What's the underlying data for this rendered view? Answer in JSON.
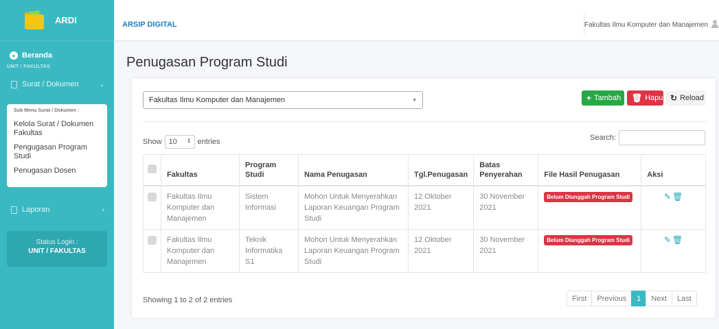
{
  "brand": {
    "name": "ARDI",
    "logo": "folder-logo-icon"
  },
  "sidebar": {
    "beranda": "Beranda",
    "section_label": "UNIT / FAKULTAS",
    "surat_menu": "Surat / Dokumen",
    "submenu_title": "Sub Menu Surat / Dokumen :",
    "submenu_items": [
      "Kelola Surat / Dokumen Fakultas",
      "Pengugasan Program Studi",
      "Penugasan Dosen"
    ],
    "laporan": "Laporan",
    "status_label": "Status Login :",
    "status_value": "UNIT / FAKULTAS"
  },
  "topbar": {
    "app_title": "ARSIP DIGITAL",
    "user": "Fakultas Ilmu Komputer dan Manajemen"
  },
  "page": {
    "title": "Penugasan Program Studi"
  },
  "filter": {
    "selected": "Fakultas Ilmu Komputer dan Manajemen"
  },
  "buttons": {
    "tambah": "Tambah",
    "hapus": "Hapus",
    "reload": "Reload"
  },
  "table_controls": {
    "show": "Show",
    "length": "10",
    "entries": "entries",
    "search_label": "Search:"
  },
  "table": {
    "headers": [
      "Fakultas",
      "Program Studi",
      "Nama Penugasan",
      "Tgl.Penugasan",
      "Batas Penyerahan",
      "File Hasil Penugasan",
      "Aksi"
    ],
    "rows": [
      {
        "fakultas": "Fakultas Ilmu Komputer dan Manajemen",
        "prodi": "Sistem Informasi",
        "nama": "Mohon Untuk Menyerahkan Laporan Keuangan Program Studi",
        "tgl": "12 Oktober 2021",
        "batas": "30 November 2021",
        "file": "Belum Diunggah Program Studi"
      },
      {
        "fakultas": "Fakultas Ilmu Komputer dan Manajemen",
        "prodi": "Teknik Informatika S1",
        "nama": "Mohon Untuk Menyerahkan Laporan Keuangan Program Studi",
        "tgl": "12 Oktober 2021",
        "batas": "30 November 2021",
        "file": "Belum Diunggah Program Studi"
      }
    ]
  },
  "footer": {
    "info": "Showing 1 to 2 of 2 entries",
    "pager": {
      "first": "First",
      "previous": "Previous",
      "current": "1",
      "next": "Next",
      "last": "Last"
    }
  },
  "colors": {
    "sidebar": "#3bb9c2",
    "accent": "#1b7fc2",
    "success": "#28a745",
    "danger": "#dc3545"
  }
}
